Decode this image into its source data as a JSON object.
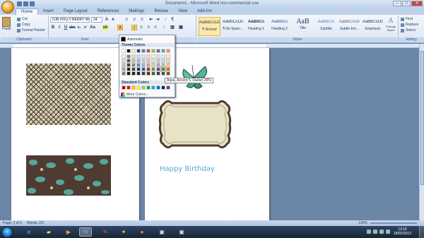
{
  "window": {
    "title": "Document1 - Microsoft Word non-commercial use",
    "minimize": "–",
    "maximize": "□",
    "close": "✕"
  },
  "tabs": [
    "Home",
    "Insert",
    "Page Layout",
    "References",
    "Mailings",
    "Review",
    "View",
    "Add-Ins"
  ],
  "clipboard": {
    "paste": "Paste",
    "cut": "Cut",
    "copy": "Copy",
    "format_painter": "Format Painter",
    "group_label": "Clipboard"
  },
  "font": {
    "name": "DJB HOLLY BERRY WOR",
    "size": "24",
    "group_label": "Font"
  },
  "paragraph": {
    "group_label": "Paragraph"
  },
  "styles": {
    "group_label": "Styles",
    "items": [
      {
        "preview": "AaBbCcDc",
        "name": "¶ Normal"
      },
      {
        "preview": "AaBbCcDc",
        "name": "¶ No Spaci..."
      },
      {
        "preview": "AaBbCc",
        "name": "Heading 1"
      },
      {
        "preview": "AaBbCc",
        "name": "Heading 2"
      },
      {
        "preview": "AaB",
        "name": "Title"
      },
      {
        "preview": "AaBbCcI",
        "name": "Subtitle"
      },
      {
        "preview": "AaBbCcDc",
        "name": "Subtle Em..."
      },
      {
        "preview": "AaBbCcDc",
        "name": "Emphasis"
      }
    ],
    "change_styles": "Change Styles"
  },
  "editing": {
    "group_label": "Editing",
    "find": "Find",
    "replace": "Replace",
    "select": "Select"
  },
  "font_color_menu": {
    "automatic": "Automatic",
    "theme_colors_label": "Theme Colors",
    "standard_colors_label": "Standard Colors",
    "more_colors": "More Colors...",
    "tooltip": "Aqua, Accent 5, Darker 25%",
    "theme_top_row": [
      "#ffffff",
      "#000000",
      "#eeece1",
      "#1f497d",
      "#4f81bd",
      "#c0504d",
      "#9bbb59",
      "#8064a2",
      "#4bacc6",
      "#f79646"
    ],
    "theme_shades": [
      [
        "#f2f2f2",
        "#7f7f7f",
        "#ddd9c3",
        "#c6d9f0",
        "#dbe5f1",
        "#f2dcdb",
        "#ebf1dd",
        "#e5e0ec",
        "#dbeef3",
        "#fdeada"
      ],
      [
        "#d8d8d8",
        "#595959",
        "#c4bd97",
        "#8db3e2",
        "#b8cce4",
        "#e5b9b7",
        "#d7e3bc",
        "#ccc1d9",
        "#b7dde8",
        "#fbd5b5"
      ],
      [
        "#bfbfbf",
        "#3f3f3f",
        "#938953",
        "#548dd4",
        "#95b3d7",
        "#d99694",
        "#c3d69b",
        "#b2a2c7",
        "#92cddc",
        "#fac08f"
      ],
      [
        "#a5a5a5",
        "#262626",
        "#494429",
        "#17365d",
        "#366092",
        "#953734",
        "#76923c",
        "#5f497a",
        "#31859b",
        "#e36c09"
      ],
      [
        "#7f7f7f",
        "#0c0c0c",
        "#1d1b10",
        "#0f243e",
        "#244061",
        "#632423",
        "#4f6128",
        "#3f3151",
        "#205867",
        "#974806"
      ]
    ],
    "standard": [
      "#c00000",
      "#ff0000",
      "#ffc000",
      "#ffff00",
      "#92d050",
      "#00b050",
      "#00b0f0",
      "#0070c0",
      "#002060",
      "#7030a0"
    ]
  },
  "document": {
    "text": "Happy Birthday"
  },
  "status": {
    "page": "Page: 2 of 2",
    "words": "Words: 2/2",
    "zoom": "100%"
  },
  "clock": {
    "time": "13:16",
    "date": "18/02/2012"
  }
}
